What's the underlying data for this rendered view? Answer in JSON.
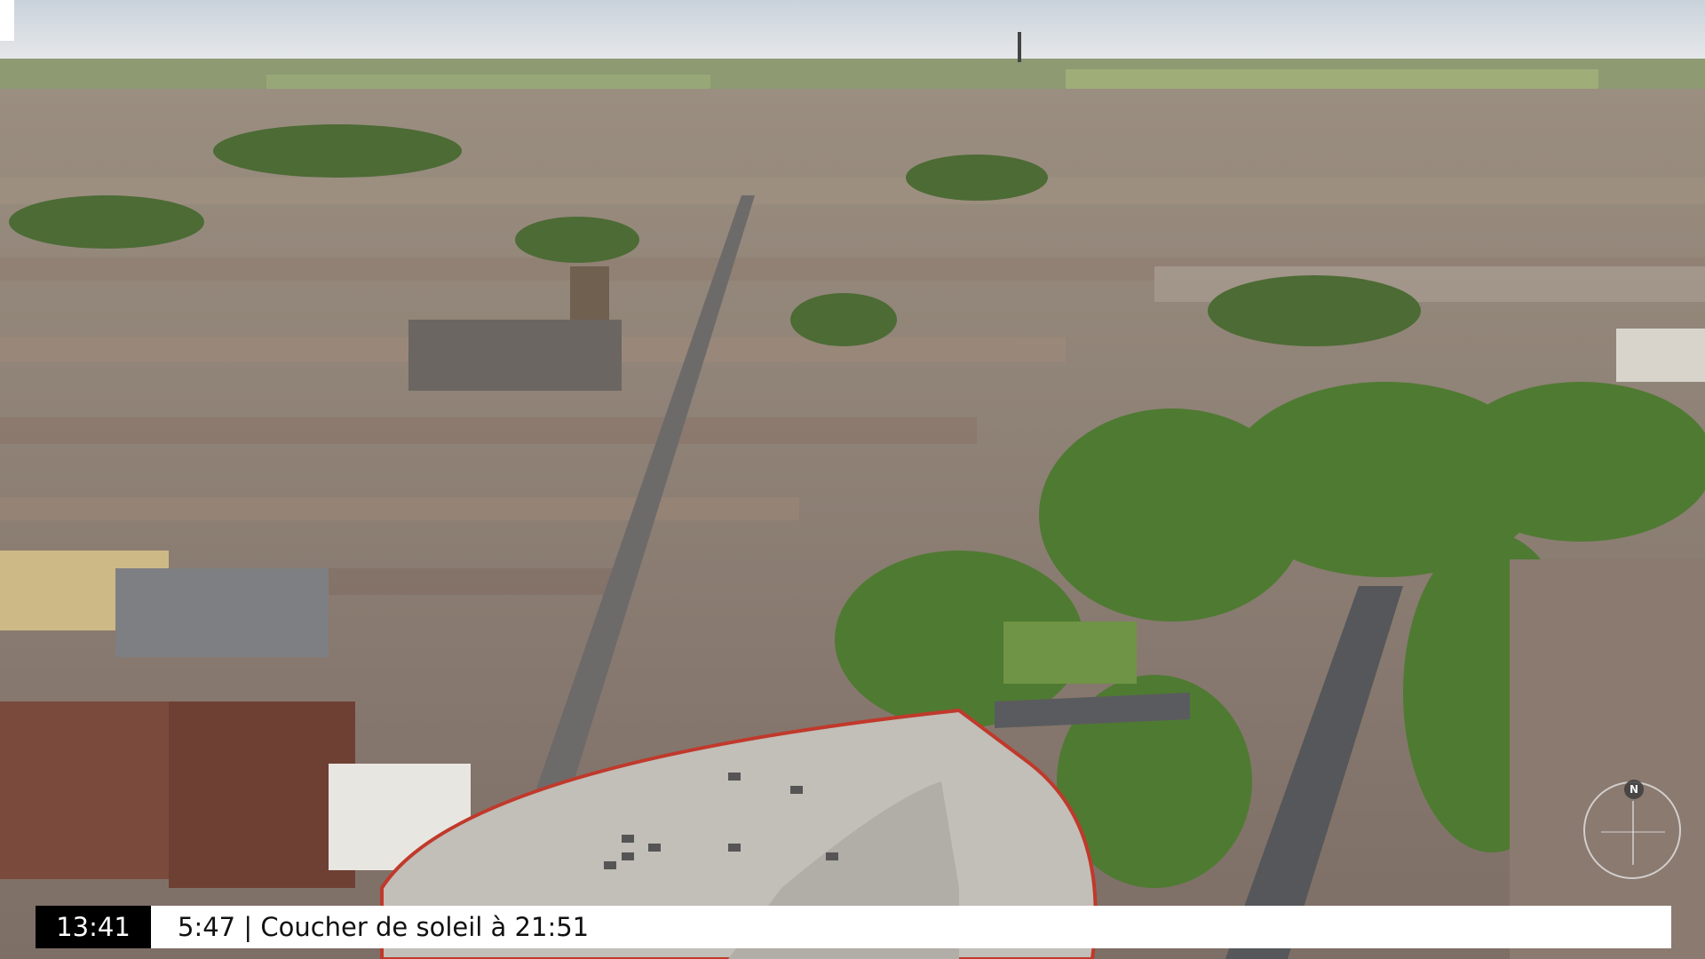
{
  "overlay": {
    "time": "13:41",
    "sun_info": "5:47 | Coucher de soleil à 21:51"
  },
  "compass": {
    "north_label": "N"
  },
  "colors": {
    "clock_bg": "#000000",
    "clock_text": "#ffffff",
    "info_bg": "#ffffff",
    "info_text": "#111111",
    "roof_rim": "#c0392b"
  },
  "icons": {
    "compass": "compass-icon"
  }
}
